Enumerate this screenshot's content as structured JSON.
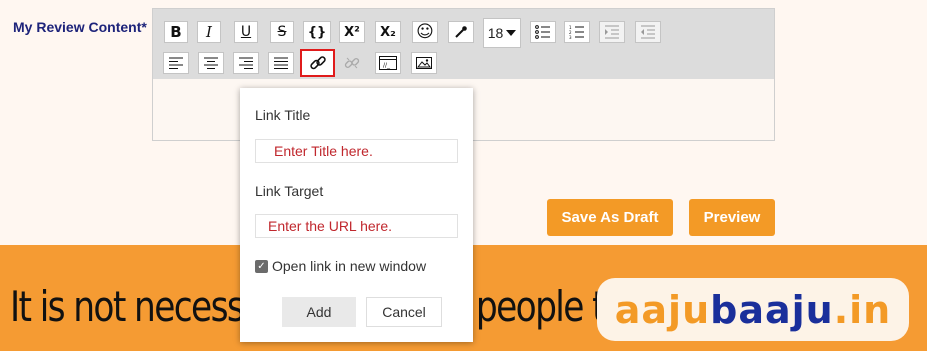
{
  "form": {
    "label": "My Review Content*"
  },
  "toolbar": {
    "font_size": "18",
    "row1": [
      {
        "name": "bold-button",
        "glyph": "B"
      },
      {
        "name": "italic-button",
        "glyph": "I"
      },
      {
        "name": "underline-button",
        "glyph": "U"
      },
      {
        "name": "strikethrough-button",
        "glyph": "S"
      },
      {
        "name": "code-button",
        "glyph": "{}"
      },
      {
        "name": "superscript-button",
        "glyph": "X²"
      },
      {
        "name": "subscript-button",
        "glyph": "X₂"
      },
      {
        "name": "emoji-button",
        "glyph": "☺"
      }
    ]
  },
  "actions": {
    "save_draft": "Save As Draft",
    "preview": "Preview"
  },
  "link_dialog": {
    "title_label": "Link Title",
    "title_placeholder": "Enter Title here.",
    "target_label": "Link Target",
    "target_placeholder": "Enter the URL here.",
    "new_window_label": "Open link in new window",
    "new_window_checked": true,
    "add_label": "Add",
    "cancel_label": "Cancel"
  },
  "banner": {
    "text_left": "It is not necessa",
    "text_right": "people to",
    "logo_part1": "aaju",
    "logo_part2": "baaju",
    "logo_part3": ".in"
  },
  "colors": {
    "accent": "#f39a26",
    "brand_blue": "#1a2f9b",
    "highlight": "#e01b1b"
  }
}
